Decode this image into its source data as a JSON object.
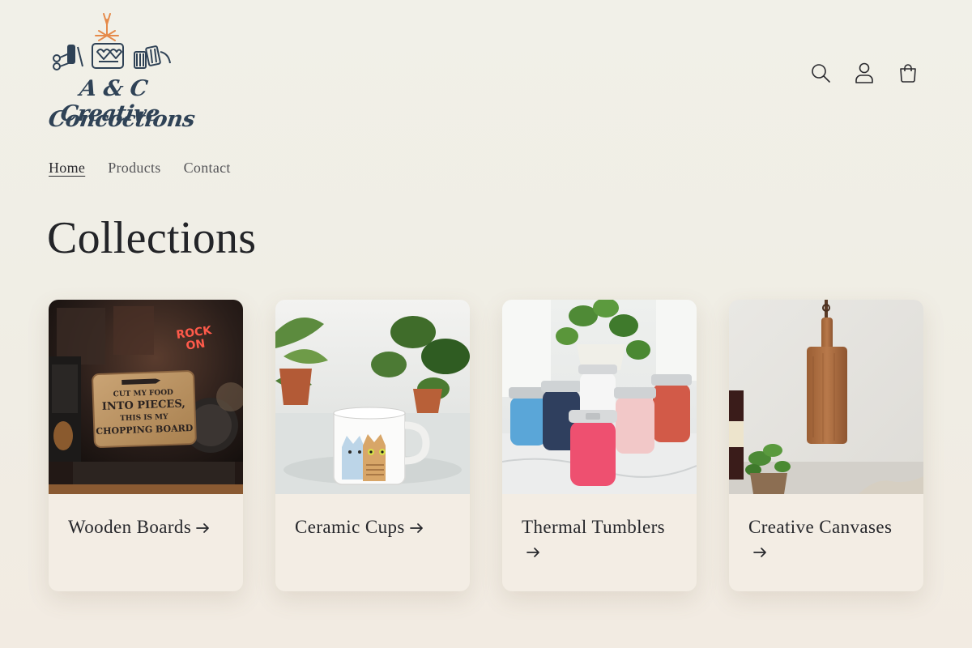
{
  "brand": {
    "logo_line1": "A & C Creative",
    "logo_line2": "Concoctions"
  },
  "header": {
    "icons": [
      "search-icon",
      "account-icon",
      "cart-icon"
    ]
  },
  "nav": {
    "items": [
      {
        "label": "Home",
        "active": true
      },
      {
        "label": "Products",
        "active": false
      },
      {
        "label": "Contact",
        "active": false
      }
    ]
  },
  "main": {
    "title": "Collections",
    "collections": [
      {
        "label": "Wooden Boards",
        "board_text_1": "CUT MY FOOD",
        "board_text_2": "INTO PIECES,",
        "board_text_3": "THIS IS MY",
        "board_text_4": "CHOPPING BOARD",
        "neon_1": "ROCK",
        "neon_2": "ON"
      },
      {
        "label": "Ceramic Cups"
      },
      {
        "label": "Thermal Tumblers"
      },
      {
        "label": "Creative Canvases"
      }
    ]
  },
  "colors": {
    "background": "#f1efe6",
    "card_background": "#f3ede4",
    "logo_text": "#2f4256",
    "logo_accent": "#e58a4a"
  }
}
